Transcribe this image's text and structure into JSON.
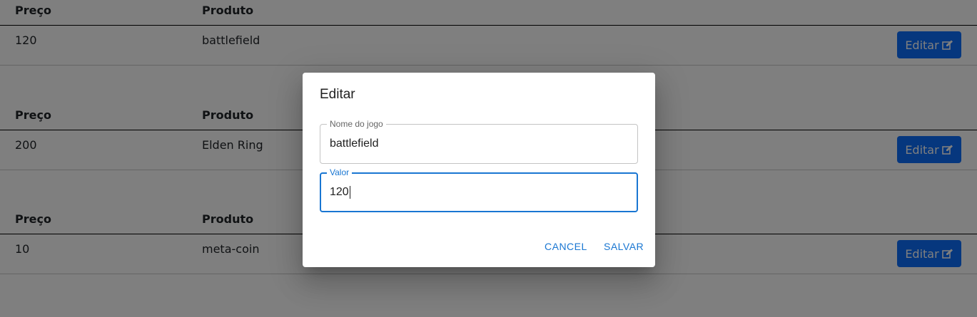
{
  "table": {
    "header_price": "Preço",
    "header_product": "Produto",
    "edit_label": "Editar",
    "rows": [
      {
        "price": "120",
        "product": "battlefield"
      },
      {
        "price": "200",
        "product": "Elden Ring"
      },
      {
        "price": "10",
        "product": "meta-coin"
      }
    ]
  },
  "dialog": {
    "title": "Editar",
    "name_field": {
      "label": "Nome do jogo",
      "value": "battlefield"
    },
    "value_field": {
      "label": "Valor",
      "value": "120"
    },
    "cancel_label": "CANCEL",
    "save_label": "SALVAR"
  },
  "colors": {
    "primary": "#0d6efd",
    "accent": "#1976d2"
  },
  "icons": {
    "edit": "pencil-square-icon"
  }
}
